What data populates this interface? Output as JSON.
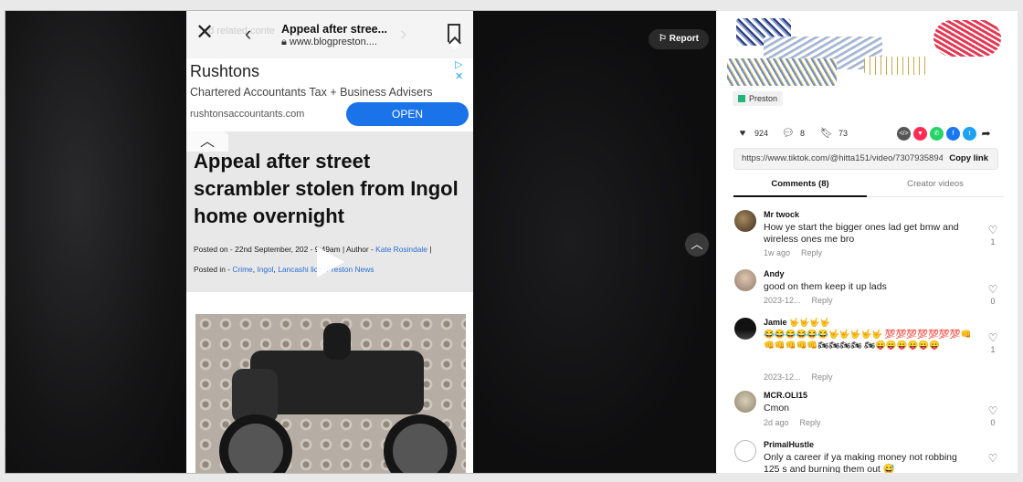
{
  "phone": {
    "ghost_text": "nd related conte",
    "title": "Appeal after stree...",
    "url": "www.blogpreston....",
    "ad": {
      "name": "Rushtons",
      "subtitle": "Chartered Accountants Tax + Business Advisers",
      "domain": "rushtonsaccountants.com",
      "cta": "OPEN"
    },
    "article": {
      "headline": "Appeal after street scrambler stolen from Ingol home overnight",
      "meta1_prefix": "Posted on - 22nd September, 202",
      "meta1_mid": " - 9:49am | Author - ",
      "author": "Kate Rosindale",
      "meta1_suffix": " |",
      "meta2_prefix": "Posted in - ",
      "cat1": "Crime",
      "cat2": "Ingol",
      "cat3": "Lancashi",
      "cat4": "lice",
      "cat5": "Preston News"
    }
  },
  "report_label": "Report",
  "panel": {
    "location": "Preston",
    "likes": "924",
    "comments_count": "8",
    "saves": "73",
    "link_url": "https://www.tiktok.com/@hitta151/video/7307935894...",
    "copy_label": "Copy link",
    "tab_comments": "Comments (8)",
    "tab_creator": "Creator videos"
  },
  "comments": [
    {
      "name": "Mr twock",
      "text": "How ye start the bigger ones lad get bmw and wireless ones me bro",
      "time": "1w ago",
      "reply": "Reply",
      "likes": "1"
    },
    {
      "name": "Andy",
      "text": "good on them keep it up lads",
      "time": "2023-12...",
      "reply": "Reply",
      "likes": "0"
    },
    {
      "name": "Jamie 🤟🤟🤟🤟",
      "text": "😂😂😂😂😂😂🤟🤟🤟🤟🤟 💯💯💯💯💯💯💯👊👊👊👊👊👊🏍🏍🏍🏍 🏍😛😛😛😛😛😛",
      "time": "2023-12...",
      "reply": "Reply",
      "likes": "1"
    },
    {
      "name": "MCR.OLI15",
      "text": "Cmon",
      "time": "2d ago",
      "reply": "Reply",
      "likes": "0"
    },
    {
      "name": "PrimalHustle",
      "text": "Only a career if ya making money not robbing 125 s and burning them out 😅",
      "time": "",
      "reply": "",
      "likes": ""
    }
  ],
  "colors": {
    "accent_blue": "#1a73e8",
    "viewer_bg": "#0f0f10",
    "link_blue": "#2a6fd1"
  }
}
